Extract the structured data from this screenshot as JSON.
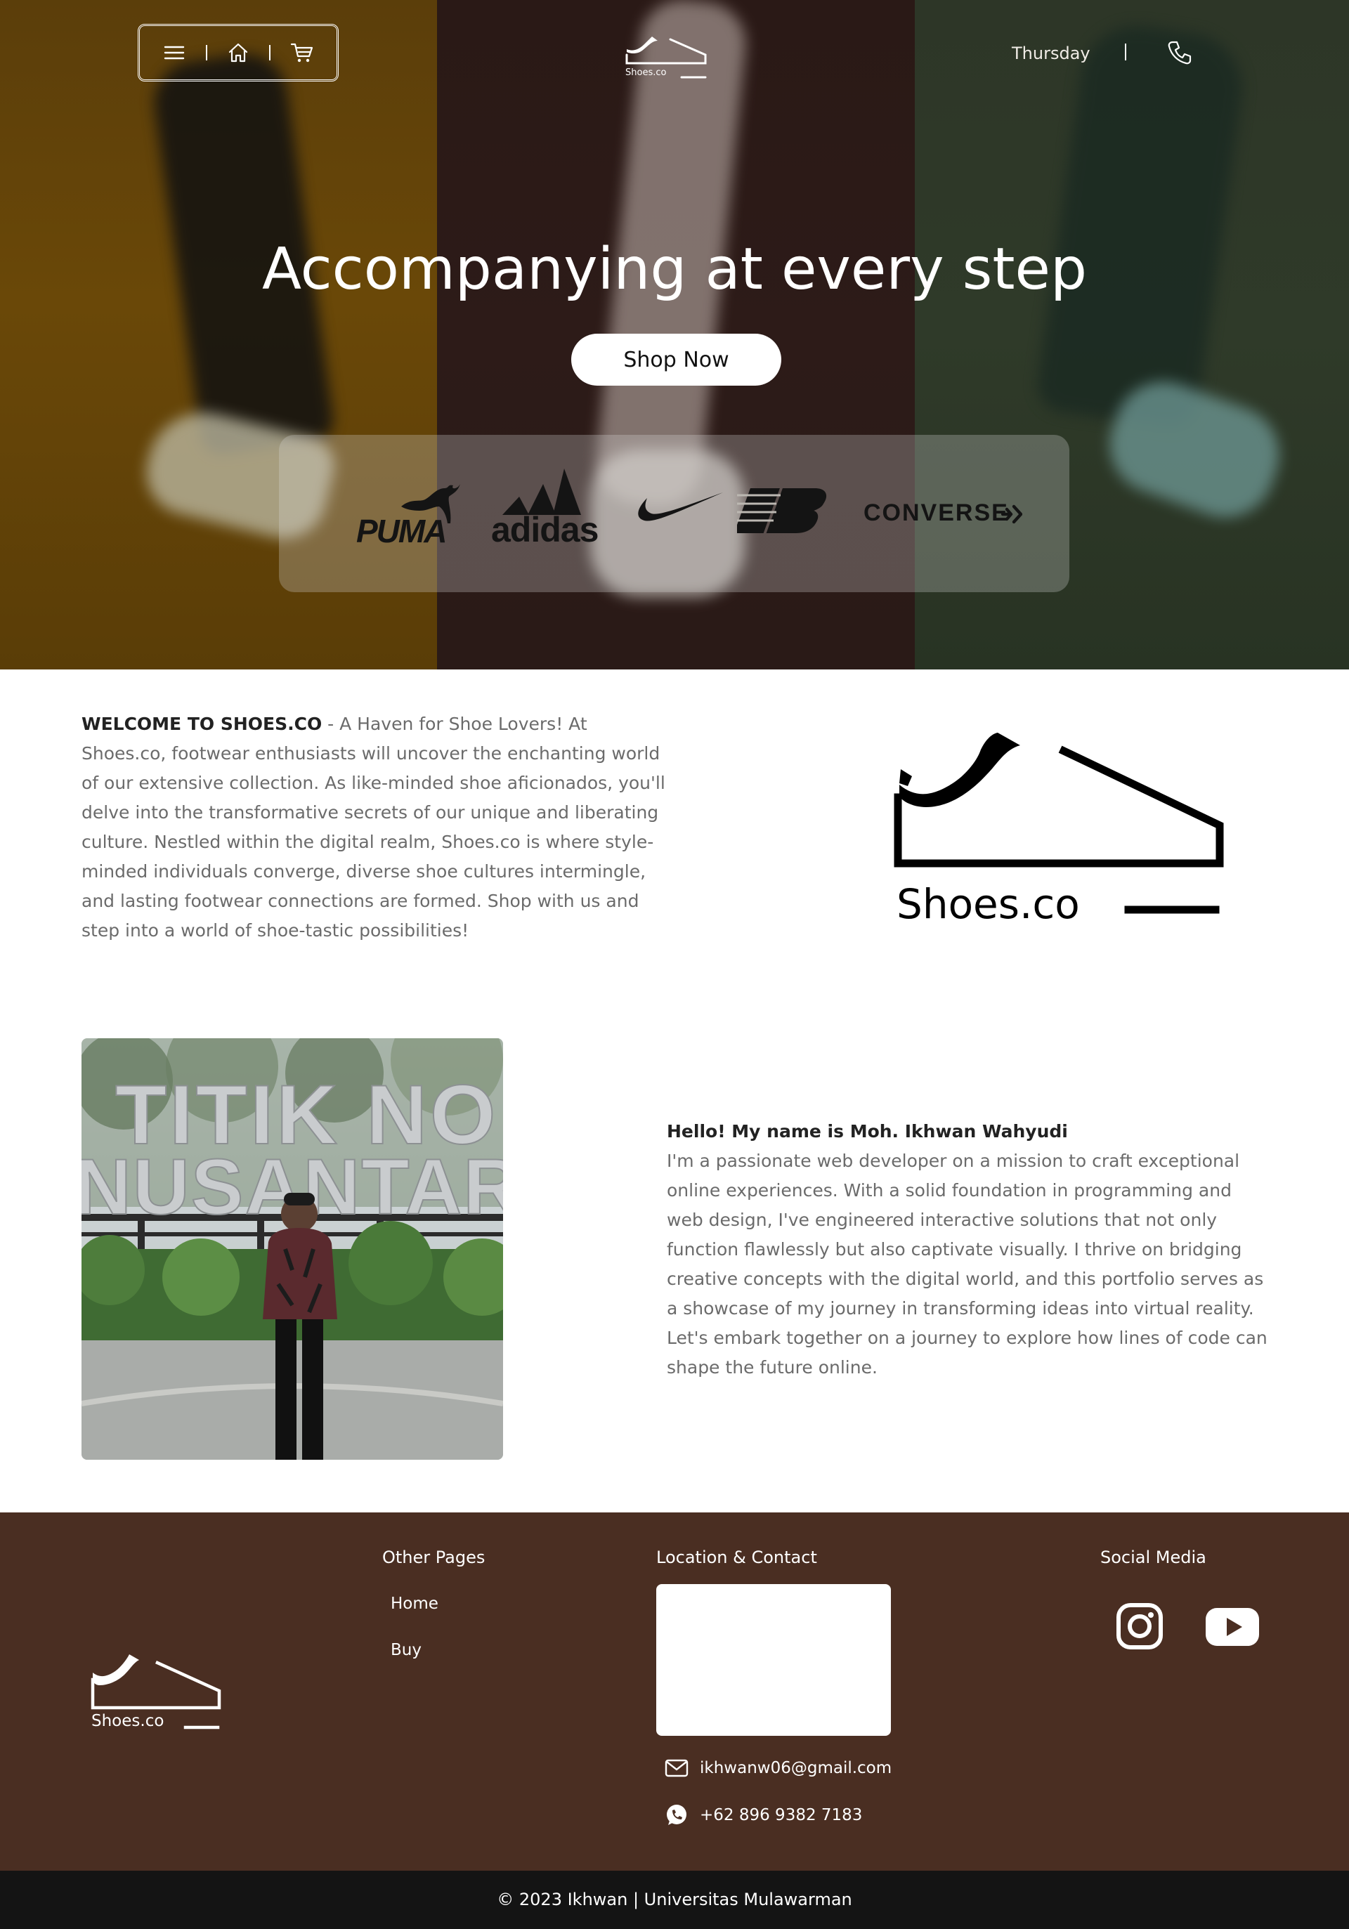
{
  "nav": {
    "menu_icon": "hamburger-icon",
    "home_icon": "home-icon",
    "cart_icon": "cart-icon",
    "logo_text": "Shoes.co",
    "day": "Thursday",
    "phone_icon": "phone-icon"
  },
  "hero": {
    "title": "Accompanying at every step",
    "cta_label": "Shop Now",
    "brands": [
      "PUMA",
      "adidas",
      "nike",
      "new balance",
      "CONVERSE"
    ],
    "brand_text": {
      "puma": "PUMA",
      "adidas": "adidas",
      "converse": "CONVERSE"
    }
  },
  "welcome": {
    "heading": "WELCOME TO SHOES.CO",
    "body": " - A Haven for Shoe Lovers! At Shoes.co, footwear enthusiasts will uncover the enchanting world of our extensive collection. As like-minded shoe aficionados, you'll delve into the transformative secrets of our unique and liberating culture. Nestled within the digital realm, Shoes.co is where style-minded individuals converge, diverse shoe cultures intermingle, and lasting footwear connections are formed. Shop with us and step into a world of shoe-tastic possibilities!",
    "logo_text": "Shoes.co"
  },
  "about": {
    "photo_sign_line1": "TITIK NOL",
    "photo_sign_line2": "NUSANTARA",
    "heading": "Hello! My name is Moh. Ikhwan Wahyudi",
    "body": "I'm a passionate web developer on a mission to craft exceptional online experiences. With a solid foundation in programming and web design, I've engineered interactive solutions that not only function flawlessly but also captivate visually. I thrive on bridging creative concepts with the digital world, and this portfolio serves as a showcase of my journey in transforming ideas into virtual reality. Let's embark together on a journey to explore how lines of code can shape the future online."
  },
  "footer": {
    "logo_text": "Shoes.co",
    "other_pages_title": "Other Pages",
    "links": [
      "Home",
      "Buy"
    ],
    "contact_title": "Location & Contact",
    "email": "ikhwanw06@gmail.com",
    "phone": "+62 896 9382 7183",
    "social_title": "Social Media",
    "social_icons": [
      "instagram-icon",
      "youtube-icon"
    ],
    "copyright": "© 2023 Ikhwan | Universitas Mulawarman"
  },
  "colors": {
    "footer_bg": "#4a2e22",
    "bottom_bar_bg": "#141414",
    "hero_left": "#6a4808",
    "hero_mid": "#2d1b18",
    "hero_right": "#2f3a29"
  }
}
